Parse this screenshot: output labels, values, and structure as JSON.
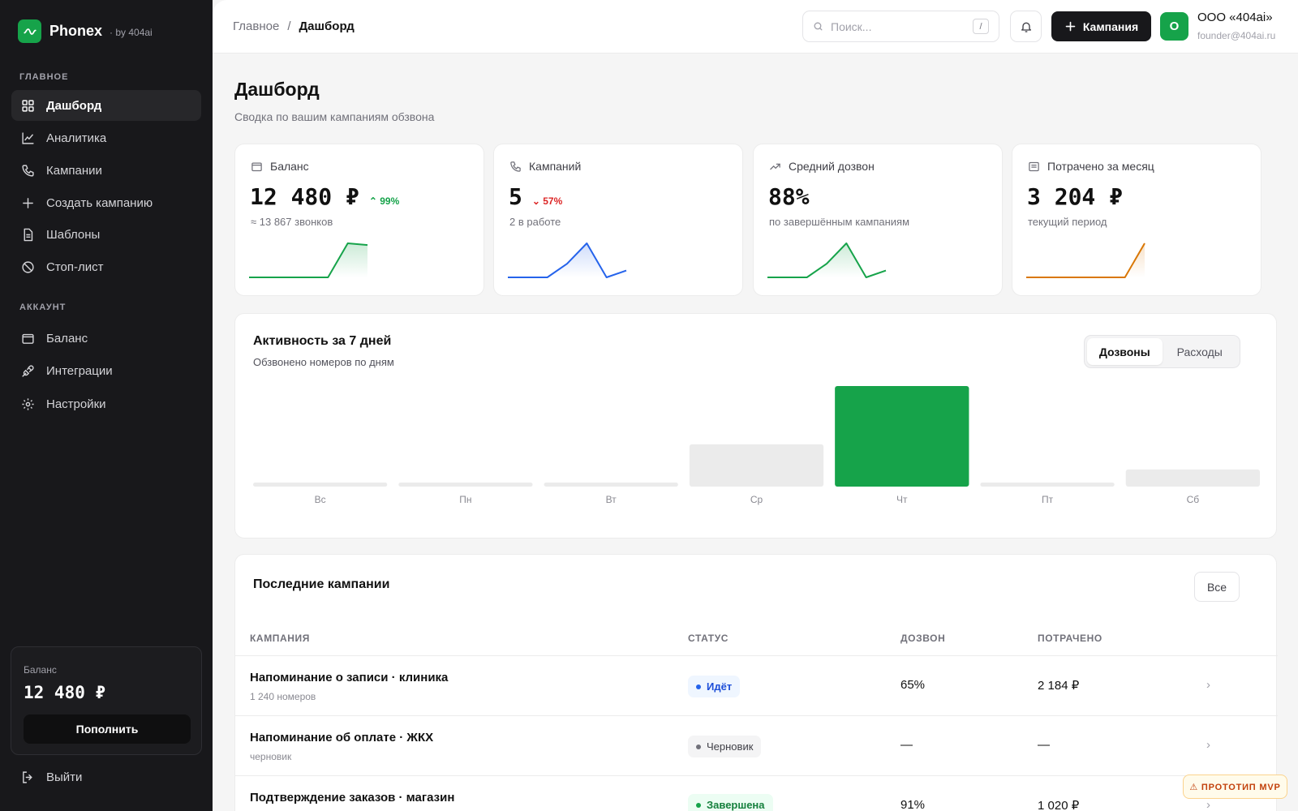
{
  "brand": {
    "name": "Phonex",
    "by": "· by 404ai",
    "accent": "#16a34a"
  },
  "sidebar": {
    "section_main": "ГЛАВНОЕ",
    "section_account": "АККАУНТ",
    "items": [
      {
        "label": "Дашборд",
        "icon": "grid-icon",
        "active": true
      },
      {
        "label": "Аналитика",
        "icon": "chart-icon"
      },
      {
        "label": "Кампании",
        "icon": "phone-icon"
      },
      {
        "label": "Создать кампанию",
        "icon": "plus-icon"
      },
      {
        "label": "Шаблоны",
        "icon": "document-icon"
      },
      {
        "label": "Стоп-лист",
        "icon": "ban-icon"
      }
    ],
    "account_items": [
      {
        "label": "Баланс",
        "icon": "wallet-icon"
      },
      {
        "label": "Интеграции",
        "icon": "plug-icon"
      },
      {
        "label": "Настройки",
        "icon": "gear-icon"
      }
    ],
    "balance": {
      "label": "Баланс",
      "value": "12 480 ₽",
      "button": "Пополнить"
    },
    "logout": "Выйти"
  },
  "topbar": {
    "breadcrumb_root": "Главное",
    "breadcrumb_sep": "/",
    "breadcrumb_current": "Дашборд",
    "search_placeholder": "Поиск...",
    "search_shortcut": "/",
    "add_button": "Кампания",
    "avatar_letter": "О",
    "org_name": "ООО «404ai»",
    "org_email": "founder@404ai.ru"
  },
  "page": {
    "title": "Дашборд",
    "subtitle": "Сводка по вашим кампаниям обзвона"
  },
  "stats": [
    {
      "title": "Баланс",
      "icon": "wallet-icon",
      "value": "12 480 ₽",
      "delta": "99%",
      "trend": "up",
      "note": "≈ 13 867 звонков",
      "color": "#16a34a",
      "spark": [
        0,
        0,
        0,
        0,
        0,
        1,
        0.95
      ]
    },
    {
      "title": "Кампаний",
      "icon": "phone-icon",
      "value": "5",
      "delta": "57%",
      "trend": "down",
      "note": "2 в работе",
      "color": "#2563eb",
      "spark": [
        0,
        0,
        0,
        0.4,
        1,
        0,
        0.2
      ]
    },
    {
      "title": "Средний дозвон",
      "icon": "trend-icon",
      "value": "88%",
      "delta": "",
      "trend": "",
      "note": "по завершённым кампаниям",
      "color": "#16a34a",
      "spark": [
        0,
        0,
        0,
        0.4,
        1,
        0,
        0.2
      ]
    },
    {
      "title": "Потрачено за месяц",
      "icon": "receipt-icon",
      "value": "3 204 ₽",
      "delta": "",
      "trend": "",
      "note": "текущий период",
      "color": "#d97706",
      "spark": [
        0,
        0,
        0,
        0,
        0,
        0,
        1
      ]
    }
  ],
  "activity": {
    "title": "Активность за 7 дней",
    "subtitle": "Обзвонено номеров по дням",
    "tabs": [
      "Дозвоны",
      "Расходы"
    ],
    "active_tab": 0
  },
  "chart_data": {
    "type": "bar",
    "categories": [
      "Вс",
      "Пн",
      "Вт",
      "Ср",
      "Чт",
      "Пт",
      "Сб"
    ],
    "values": [
      0,
      0,
      0,
      42,
      100,
      0,
      17
    ],
    "highlight_index": 4,
    "highlight_color": "#16a34a",
    "bar_color": "#ebebeb"
  },
  "recent": {
    "title": "Последние кампании",
    "all_button": "Все",
    "columns": [
      "КАМПАНИЯ",
      "СТАТУС",
      "ДОЗВОН",
      "ПОТРАЧЕНО"
    ],
    "rows": [
      {
        "name": "Напоминание о записи · клиника",
        "meta": "1 240 номеров",
        "status": "Идёт",
        "status_kind": "running",
        "rate": "65%",
        "spent": "2 184 ₽"
      },
      {
        "name": "Напоминание об оплате · ЖКХ",
        "meta": "черновик",
        "status": "Черновик",
        "status_kind": "draft",
        "rate": "—",
        "spent": "—"
      },
      {
        "name": "Подтверждение заказов · магазин",
        "meta": "",
        "status": "Завершена",
        "status_kind": "done",
        "rate": "91%",
        "spent": "1 020 ₽"
      }
    ],
    "chevron": "›"
  },
  "prototype_badge": "⚠ ПРОТОТИП MVP"
}
